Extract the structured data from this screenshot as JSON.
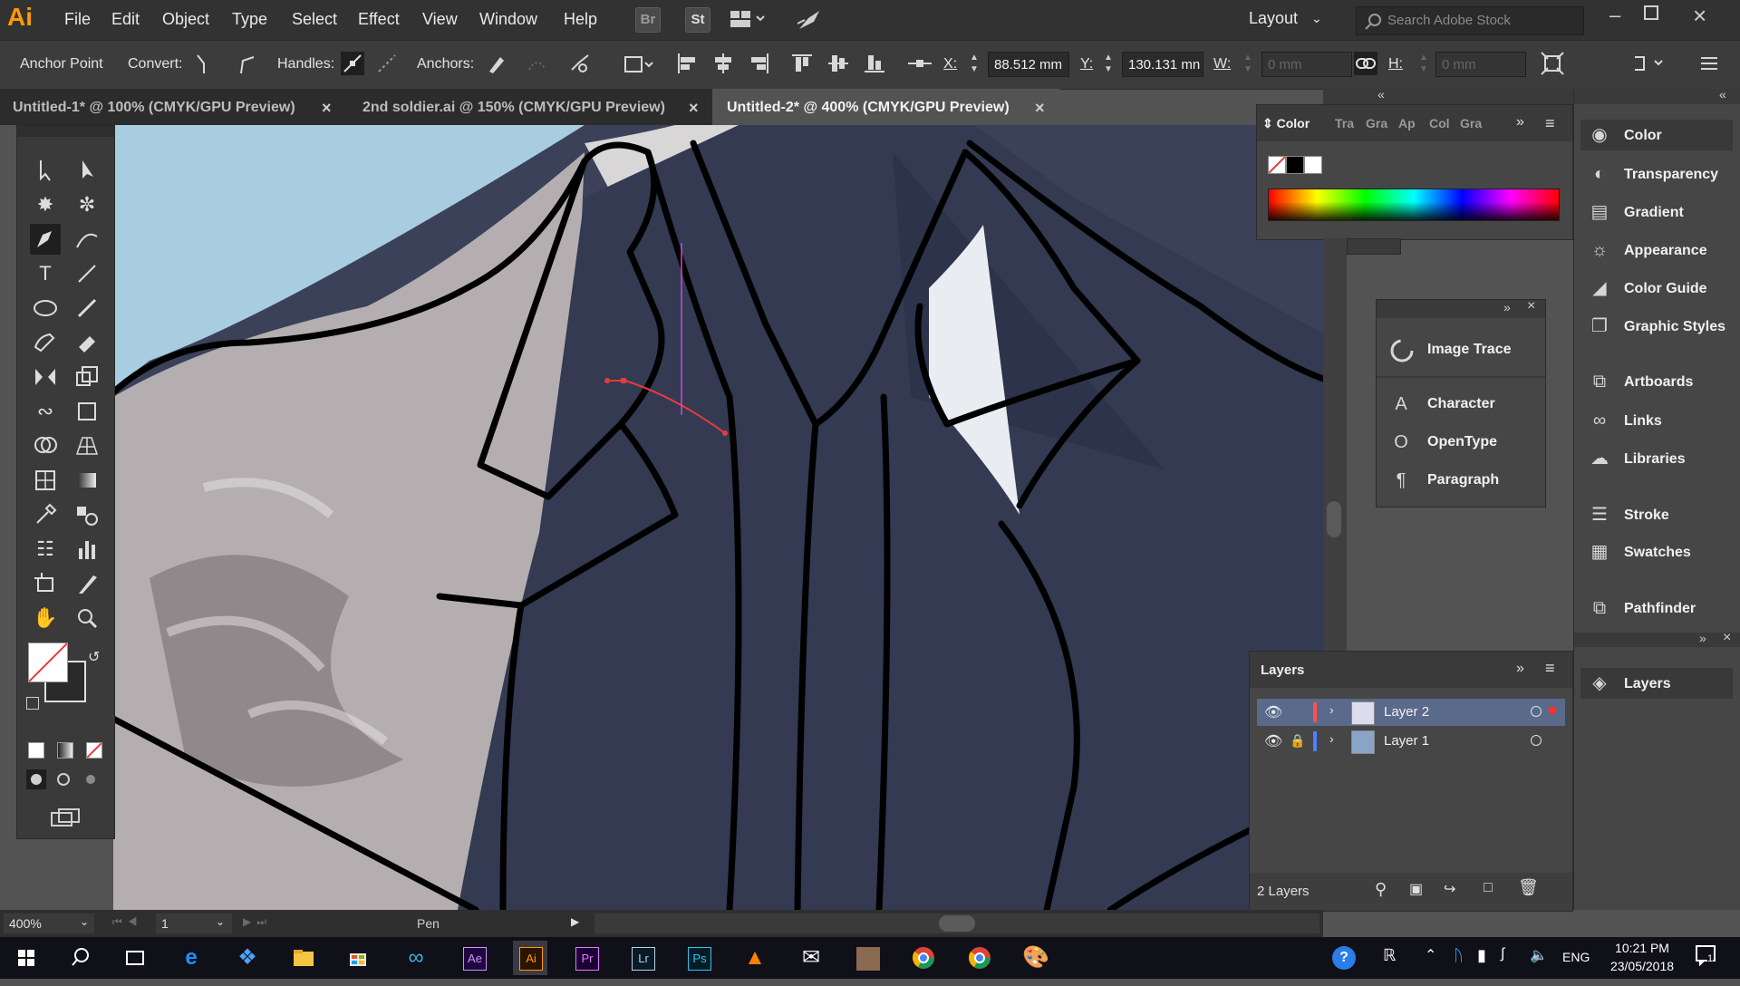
{
  "app": {
    "logo": "Ai"
  },
  "menu": [
    "File",
    "Edit",
    "Object",
    "Type",
    "Select",
    "Effect",
    "View",
    "Window",
    "Help"
  ],
  "menu_buttons": {
    "bridge": "Br",
    "stock": "St"
  },
  "workspace": {
    "label": "Layout"
  },
  "search": {
    "placeholder": "Search Adobe Stock"
  },
  "control_bar": {
    "anchor_point": "Anchor Point",
    "convert": "Convert:",
    "handles": "Handles:",
    "anchors": "Anchors:",
    "x_label": "X:",
    "x_value": "88.512 mm",
    "y_label": "Y:",
    "y_value": "130.131 mn",
    "w_label": "W:",
    "w_value": "0 mm",
    "h_label": "H:",
    "h_value": "0 mm"
  },
  "tabs": [
    {
      "label": "Untitled-1* @ 100% (CMYK/GPU Preview)"
    },
    {
      "label": "2nd soldier.ai @ 150% (CMYK/GPU Preview)"
    },
    {
      "label": "Untitled-2* @ 400% (CMYK/GPU Preview)"
    }
  ],
  "color_panel": {
    "tabs": [
      "Color",
      "Tra",
      "Gra",
      "Ap",
      "Col",
      "Gra"
    ]
  },
  "floating_panel": [
    "Image Trace",
    "Character",
    "OpenType",
    "Paragraph"
  ],
  "dock_panels": [
    {
      "label": "Color",
      "icon": "color-palette-icon"
    },
    {
      "label": "Transparency",
      "icon": "transparency-icon"
    },
    {
      "label": "Gradient",
      "icon": "gradient-icon"
    },
    {
      "label": "Appearance",
      "icon": "appearance-icon"
    },
    {
      "label": "Color Guide",
      "icon": "color-guide-icon"
    },
    {
      "label": "Graphic Styles",
      "icon": "graphic-styles-icon"
    },
    {
      "label": "Artboards",
      "icon": "artboards-icon"
    },
    {
      "label": "Links",
      "icon": "links-icon"
    },
    {
      "label": "Libraries",
      "icon": "libraries-icon"
    },
    {
      "label": "Stroke",
      "icon": "stroke-icon"
    },
    {
      "label": "Swatches",
      "icon": "swatches-icon"
    },
    {
      "label": "Pathfinder",
      "icon": "pathfinder-icon"
    },
    {
      "label": "Layers",
      "icon": "layers-icon"
    }
  ],
  "layers_panel": {
    "title": "Layers",
    "layers": [
      {
        "name": "Layer 2",
        "color": "#ff4f4f"
      },
      {
        "name": "Layer 1",
        "color": "#4f7fff"
      }
    ],
    "count": "2 Layers"
  },
  "status": {
    "zoom": "400%",
    "artboard": "1",
    "tool": "Pen"
  },
  "taskbar": {
    "apps": [
      "Ae",
      "Ai",
      "Pr",
      "Lr",
      "Ps"
    ],
    "lang": "ENG",
    "time": "10:21 PM",
    "date": "23/05/2018",
    "notifications": "1"
  },
  "colors": {
    "accent_orange": "#ff9a00",
    "path_red": "#e63b3b",
    "selection_magenta": "#d04bd0"
  }
}
